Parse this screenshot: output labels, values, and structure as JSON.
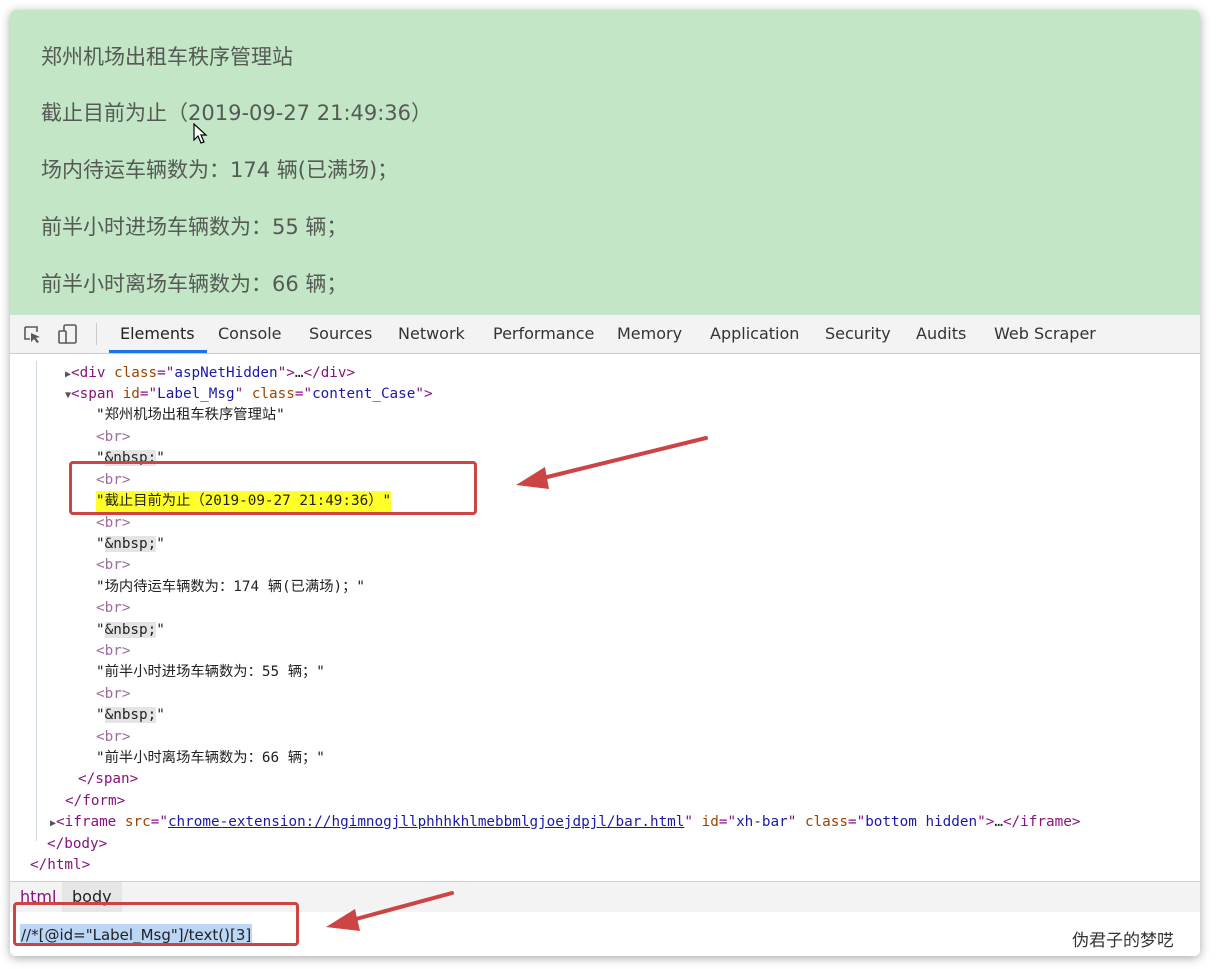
{
  "page": {
    "lines": [
      "郑州机场出租车秩序管理站",
      "截止目前为止（2019-09-27 21:49:36）",
      "场内待运车辆数为：174 辆(已满场)；",
      "前半小时进场车辆数为：55 辆；",
      "前半小时离场车辆数为：66 辆；"
    ],
    "background": "#c2e6c6"
  },
  "devtools": {
    "tabs": [
      "Elements",
      "Console",
      "Sources",
      "Network",
      "Performance",
      "Memory",
      "Application",
      "Security",
      "Audits",
      "Web Scraper"
    ],
    "active_tab": "Elements",
    "accent": "#1a73e8",
    "tree": {
      "div_collapsed": {
        "tag": "div",
        "attr": "class",
        "val": "aspNetHidden",
        "ellipsis": "…"
      },
      "span_open": {
        "tag": "span",
        "attr1": "id",
        "val1": "Label_Msg",
        "attr2": "class",
        "val2": "content_Case"
      },
      "text1": "\"郑州机场出租车秩序管理站\"",
      "br": "<br>",
      "nbsp": "\"&nbsp;\"",
      "text2": "\"截止目前为止（2019-09-27 21:49:36）\"",
      "text3": "\"场内待运车辆数为：174 辆(已满场)；\"",
      "text4": "\"前半小时进场车辆数为：55 辆；\"",
      "text5": "\"前半小时离场车辆数为：66 辆；\"",
      "span_close": "</span>",
      "form_close": "</form>",
      "iframe": {
        "tag": "iframe",
        "attr1": "src",
        "val1": "chrome-extension://hgimnogjllphhhkhlmebbmlgjoejdpjl/bar.html",
        "attr2": "id",
        "val2": "xh-bar",
        "attr3": "class",
        "val3": "bottom hidden",
        "ellipsis": "…"
      },
      "body_close": "</body>",
      "html_close": "</html>"
    },
    "breadcrumbs": [
      "html",
      "body"
    ],
    "search_value": "//*[@id=\"Label_Msg\"]/text()[3]"
  },
  "watermark": "伪君子的梦呓",
  "annotation_color": "#cd4444",
  "highlight_color": "#ffff2a"
}
